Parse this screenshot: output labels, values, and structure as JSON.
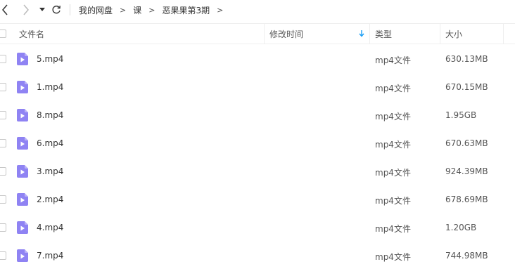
{
  "breadcrumb": {
    "items": [
      "我的网盘",
      "课",
      "恶果果第3期"
    ],
    "separator": ">"
  },
  "columns": {
    "name": "文件名",
    "modified": "修改时间",
    "type": "类型",
    "size": "大小"
  },
  "sort_indicator": {
    "column": "modified",
    "direction": "desc",
    "icon": "arrow-down-icon",
    "color": "#1a9ef5"
  },
  "file_icon": {
    "name": "video-file-icon",
    "color": "#8f83f3"
  },
  "files": [
    {
      "name": "5.mp4",
      "type": "mp4文件",
      "size": "630.13MB"
    },
    {
      "name": "1.mp4",
      "type": "mp4文件",
      "size": "670.15MB"
    },
    {
      "name": "8.mp4",
      "type": "mp4文件",
      "size": "1.95GB"
    },
    {
      "name": "6.mp4",
      "type": "mp4文件",
      "size": "670.63MB"
    },
    {
      "name": "3.mp4",
      "type": "mp4文件",
      "size": "924.39MB"
    },
    {
      "name": "2.mp4",
      "type": "mp4文件",
      "size": "678.69MB"
    },
    {
      "name": "4.mp4",
      "type": "mp4文件",
      "size": "1.20GB"
    },
    {
      "name": "7.mp4",
      "type": "mp4文件",
      "size": "744.98MB"
    }
  ]
}
